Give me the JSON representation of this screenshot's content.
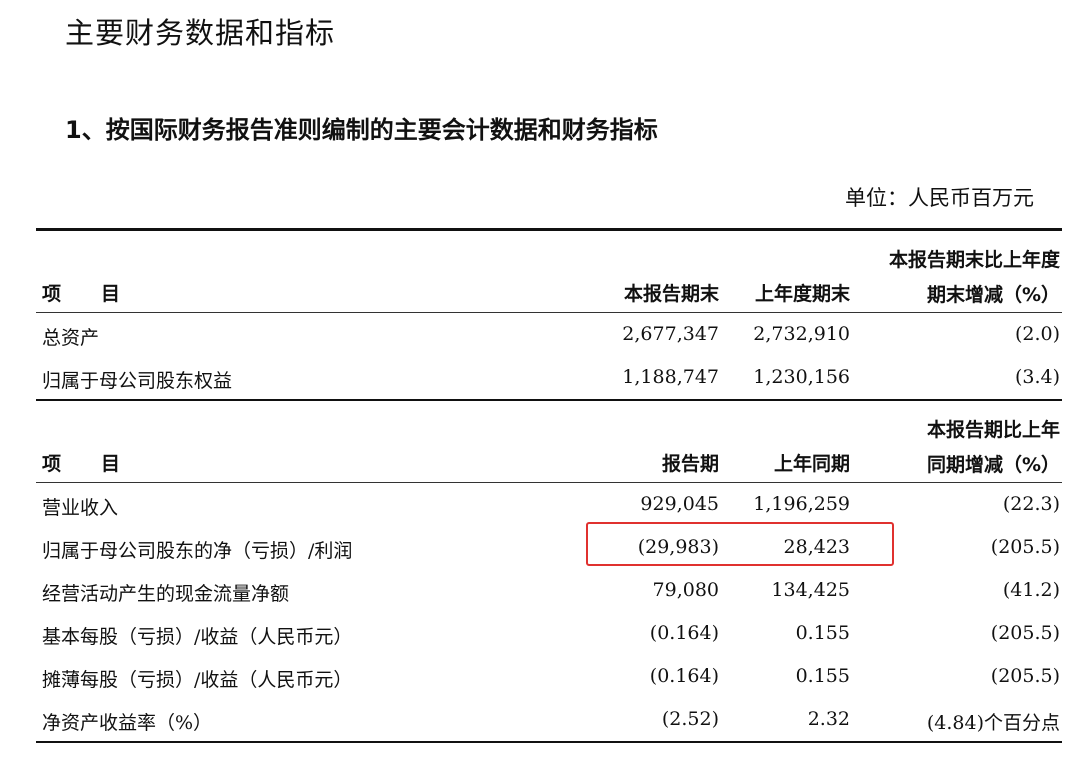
{
  "title": "主要财务数据和指标",
  "subtitle": "1、按国际财务报告准则编制的主要会计数据和财务指标",
  "unit": "单位：人民币百万元",
  "section1": {
    "header": {
      "item_a": "项",
      "item_b": "目",
      "col1": "本报告期末",
      "col2": "上年度期末",
      "col3_line1": "本报告期末比上年度",
      "col3_line2": "期末增减（%）"
    },
    "rows": [
      {
        "label": "总资产",
        "v1": "2,677,347",
        "v2": "2,732,910",
        "v3": "(2.0)"
      },
      {
        "label": "归属于母公司股东权益",
        "v1": "1,188,747",
        "v2": "1,230,156",
        "v3": "(3.4)"
      }
    ]
  },
  "section2": {
    "header": {
      "item_a": "项",
      "item_b": "目",
      "col1": "报告期",
      "col2": "上年同期",
      "col3_line1": "本报告期比上年",
      "col3_line2": "同期增减（%）"
    },
    "rows": [
      {
        "label": "营业收入",
        "v1": "929,045",
        "v2": "1,196,259",
        "v3": "(22.3)"
      },
      {
        "label": "归属于母公司股东的净（亏损）/利润",
        "v1": "(29,983)",
        "v2": "28,423",
        "v3": "(205.5)"
      },
      {
        "label": "经营活动产生的现金流量净额",
        "v1": "79,080",
        "v2": "134,425",
        "v3": "(41.2)"
      },
      {
        "label": "基本每股（亏损）/收益（人民币元）",
        "v1": "(0.164)",
        "v2": "0.155",
        "v3": "(205.5)"
      },
      {
        "label": "摊薄每股（亏损）/收益（人民币元）",
        "v1": "(0.164)",
        "v2": "0.155",
        "v3": "(205.5)"
      },
      {
        "label": "净资产收益率（%）",
        "v1": "(2.52)",
        "v2": "2.32",
        "v3": "(4.84)个百分点"
      }
    ]
  },
  "highlight_color": "#e0312f"
}
